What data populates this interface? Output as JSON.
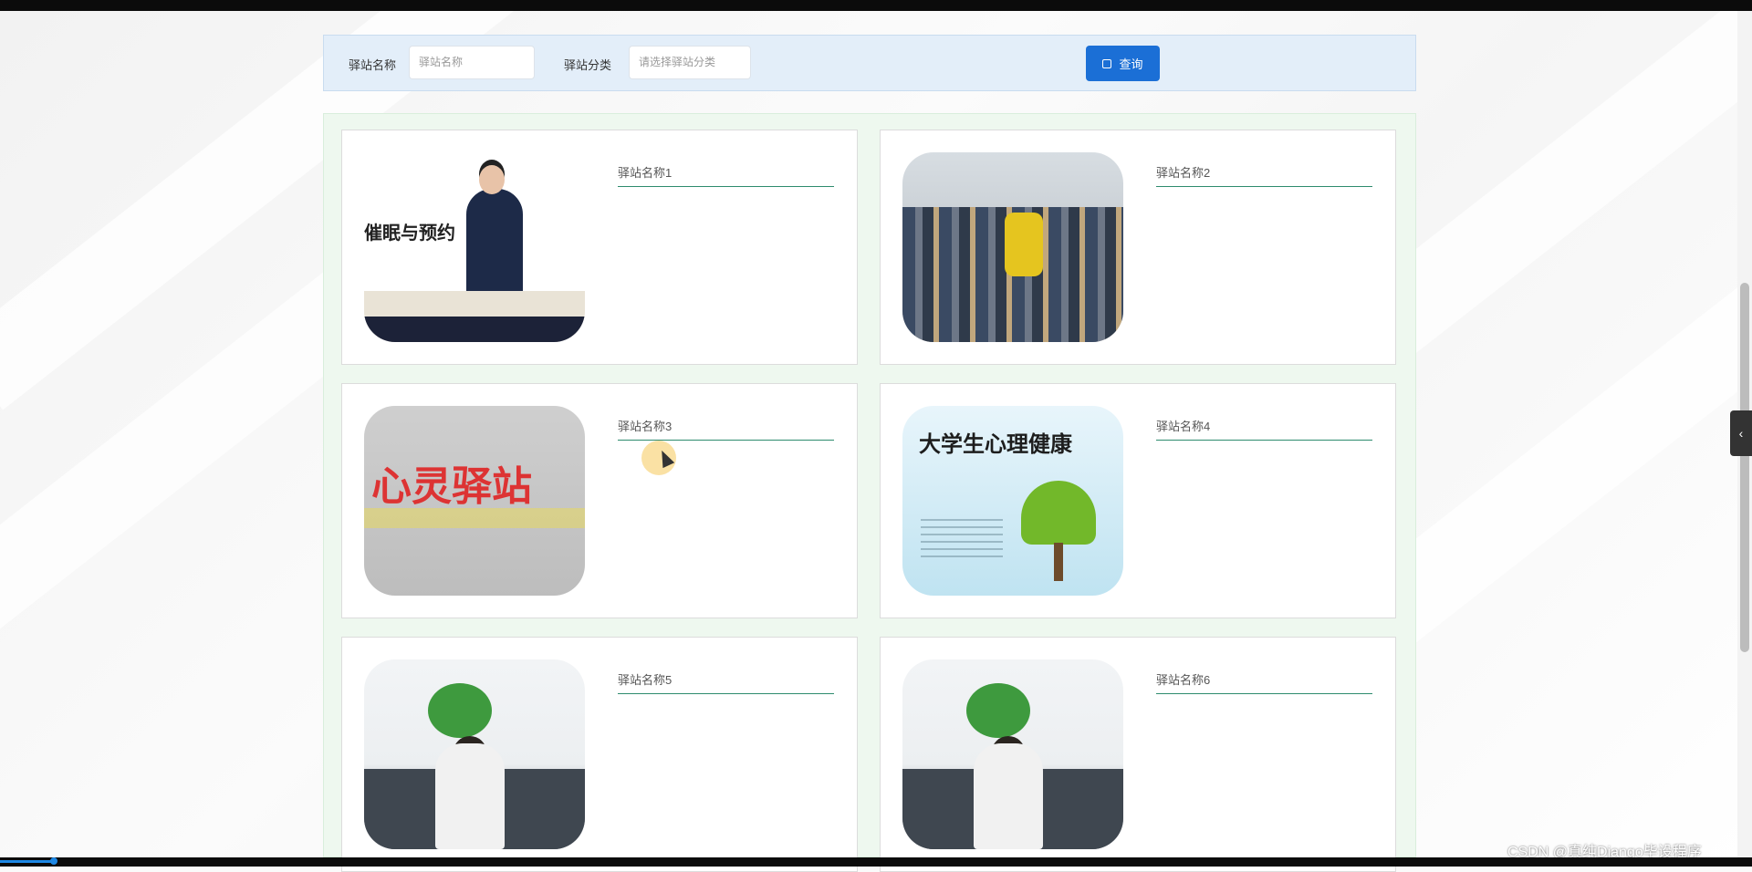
{
  "search": {
    "name_label": "驿站名称",
    "name_placeholder": "驿站名称",
    "category_label": "驿站分类",
    "category_placeholder": "请选择驿站分类",
    "button_label": "查询"
  },
  "cards": [
    {
      "title": "驿站名称1",
      "image_caption": "催眠与预约"
    },
    {
      "title": "驿站名称2"
    },
    {
      "title": "驿站名称3",
      "image_caption": "心灵驿站"
    },
    {
      "title": "驿站名称4",
      "image_caption": "大学生心理健康"
    },
    {
      "title": "驿站名称5"
    },
    {
      "title": "驿站名称6"
    }
  ],
  "side_tab_icon": "chevron-left-icon",
  "side_tab_glyph": "‹",
  "watermark": "CSDN @真纯Django毕设程序"
}
